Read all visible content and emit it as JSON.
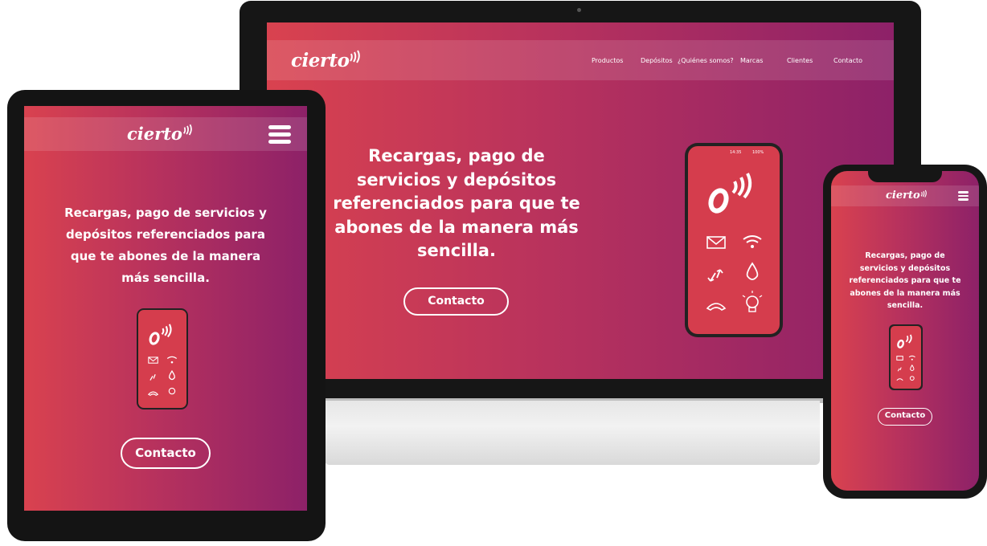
{
  "brand": {
    "logo": "cierto"
  },
  "desktop": {
    "nav": [
      "Productos",
      "Depósitos",
      "¿Quiénes somos?",
      "Marcas",
      "Clientes",
      "Contacto"
    ],
    "hero": "Recargas, pago de servicios y depósitos referenciados para que te abones de la manera más sencilla.",
    "cta": "Contacto",
    "phone_status": {
      "time": "14:35",
      "battery": "100%"
    }
  },
  "tablet": {
    "hero": "Recargas, pago de servicios y depósitos referenciados para que te abones de la manera más sencilla.",
    "cta": "Contacto"
  },
  "mobile": {
    "hero": "Recargas, pago de servicios y depósitos referenciados para que te abones de la manera más sencilla.",
    "cta": "Contacto"
  },
  "colors": {
    "gradient_start": "#d9424f",
    "gradient_mid": "#b8325d",
    "gradient_end": "#8d2168"
  },
  "icons": [
    "mail-icon",
    "wifi-icon",
    "transfer-arrows-icon",
    "water-drop-icon",
    "phone-handset-icon",
    "light-bulb-icon",
    "signal-waves-icon",
    "menu-icon"
  ]
}
